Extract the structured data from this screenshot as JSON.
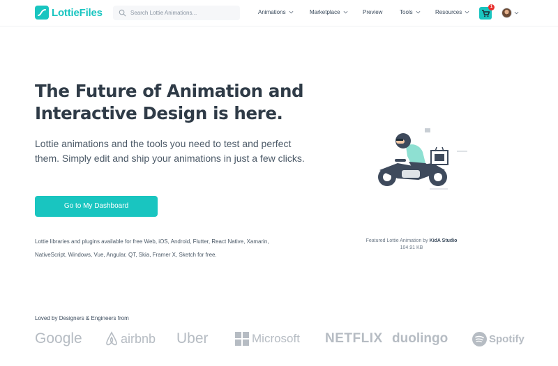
{
  "nav": {
    "logo_text": "LottieFiles",
    "search_placeholder": "Search Lottie Animations...",
    "menu": [
      {
        "label": "Animations",
        "has_dropdown": true
      },
      {
        "label": "Marketplace",
        "has_dropdown": true
      },
      {
        "label": "Preview",
        "has_dropdown": false
      },
      {
        "label": "Tools",
        "has_dropdown": true
      },
      {
        "label": "Resources",
        "has_dropdown": true
      }
    ],
    "cart_count": "1",
    "icons": [
      "search-icon",
      "cart-icon",
      "avatar",
      "chevron-down-icon"
    ]
  },
  "hero": {
    "title_line1": "The Future of Animation and",
    "title_line2": "Interactive Design is here.",
    "subtitle": "Lottie animations and the tools you need to test and perfect them. Simply edit and ship your animations in just a few clicks.",
    "cta_label": "Go to My Dashboard",
    "platforms_text": "Lottie libraries and plugins available for free Web, iOS, Android, Flutter, React Native, Xamarin, NativeScript, Windows, Vue, Angular, QT, Skia, Framer X, Sketch for free."
  },
  "featured": {
    "caption_prefix": "Featured Lottie Animation by",
    "author": "KidA Studio",
    "file_size": "104.91 KB"
  },
  "logos": {
    "heading": "Loved by Designers & Engineers from",
    "brands": [
      "Google",
      "airbnb",
      "Uber",
      "Microsoft",
      "NETFLIX",
      "duolingo",
      "Spotify"
    ]
  },
  "colors": {
    "brand": "#19c5c0",
    "heading": "#2f3b47",
    "logo_gray": "#b6bcc3",
    "badge": "#e8302e"
  }
}
